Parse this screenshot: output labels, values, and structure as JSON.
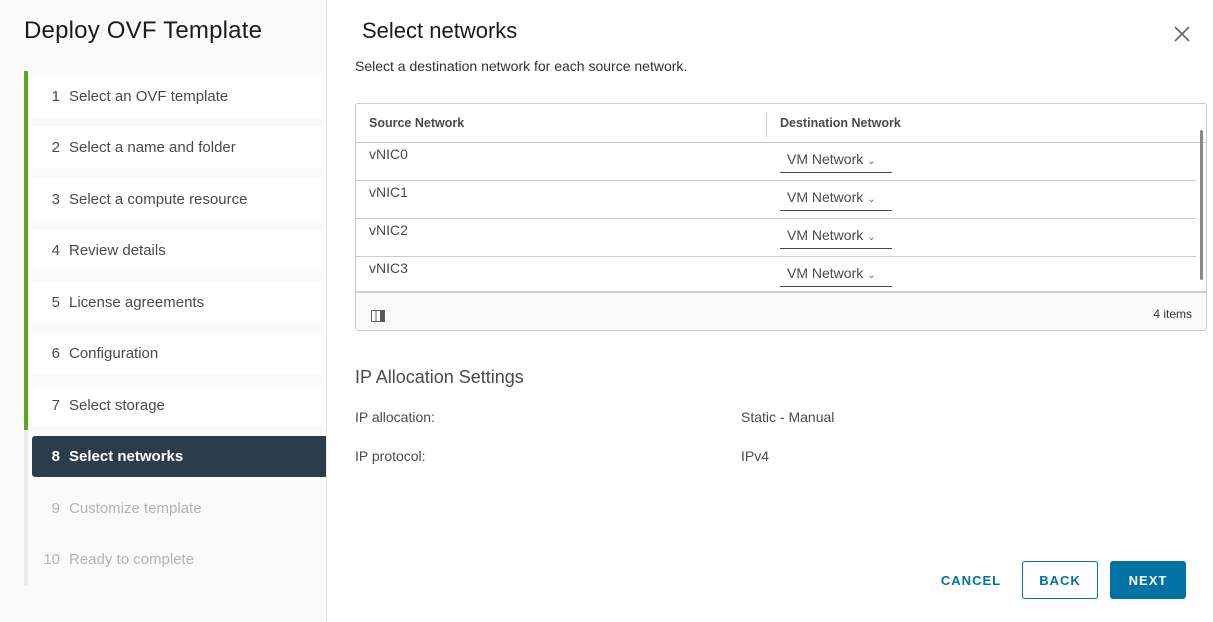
{
  "sidebar": {
    "title": "Deploy OVF Template",
    "steps": [
      {
        "num": "1",
        "label": "Select an OVF template",
        "state": "done"
      },
      {
        "num": "2",
        "label": "Select a name and folder",
        "state": "done"
      },
      {
        "num": "3",
        "label": "Select a compute resource",
        "state": "done"
      },
      {
        "num": "4",
        "label": "Review details",
        "state": "done"
      },
      {
        "num": "5",
        "label": "License agreements",
        "state": "done"
      },
      {
        "num": "6",
        "label": "Configuration",
        "state": "done"
      },
      {
        "num": "7",
        "label": "Select storage",
        "state": "done"
      },
      {
        "num": "8",
        "label": "Select networks",
        "state": "active"
      },
      {
        "num": "9",
        "label": "Customize template",
        "state": "disabled"
      },
      {
        "num": "10",
        "label": "Ready to complete",
        "state": "disabled"
      }
    ]
  },
  "main": {
    "title": "Select networks",
    "subtitle": "Select a destination network for each source network.",
    "close_icon": "close-icon",
    "grid": {
      "columns": [
        "Source Network",
        "Destination Network"
      ],
      "rows": [
        {
          "source": "vNIC0",
          "destination": "VM Network"
        },
        {
          "source": "vNIC1",
          "destination": "VM Network"
        },
        {
          "source": "vNIC2",
          "destination": "VM Network"
        },
        {
          "source": "vNIC3",
          "destination": "VM Network"
        }
      ],
      "footer_count": "4 items",
      "column_toggle_icon": "column-toggle-icon"
    },
    "ip_settings": {
      "title": "IP Allocation Settings",
      "allocation_label": "IP allocation:",
      "allocation_value": "Static - Manual",
      "protocol_label": "IP protocol:",
      "protocol_value": "IPv4"
    },
    "buttons": {
      "cancel": "CANCEL",
      "back": "BACK",
      "next": "NEXT"
    }
  },
  "colors": {
    "accent": "#0072a3",
    "step_done": "#62a420",
    "step_active_bg": "#2b3d4c"
  }
}
